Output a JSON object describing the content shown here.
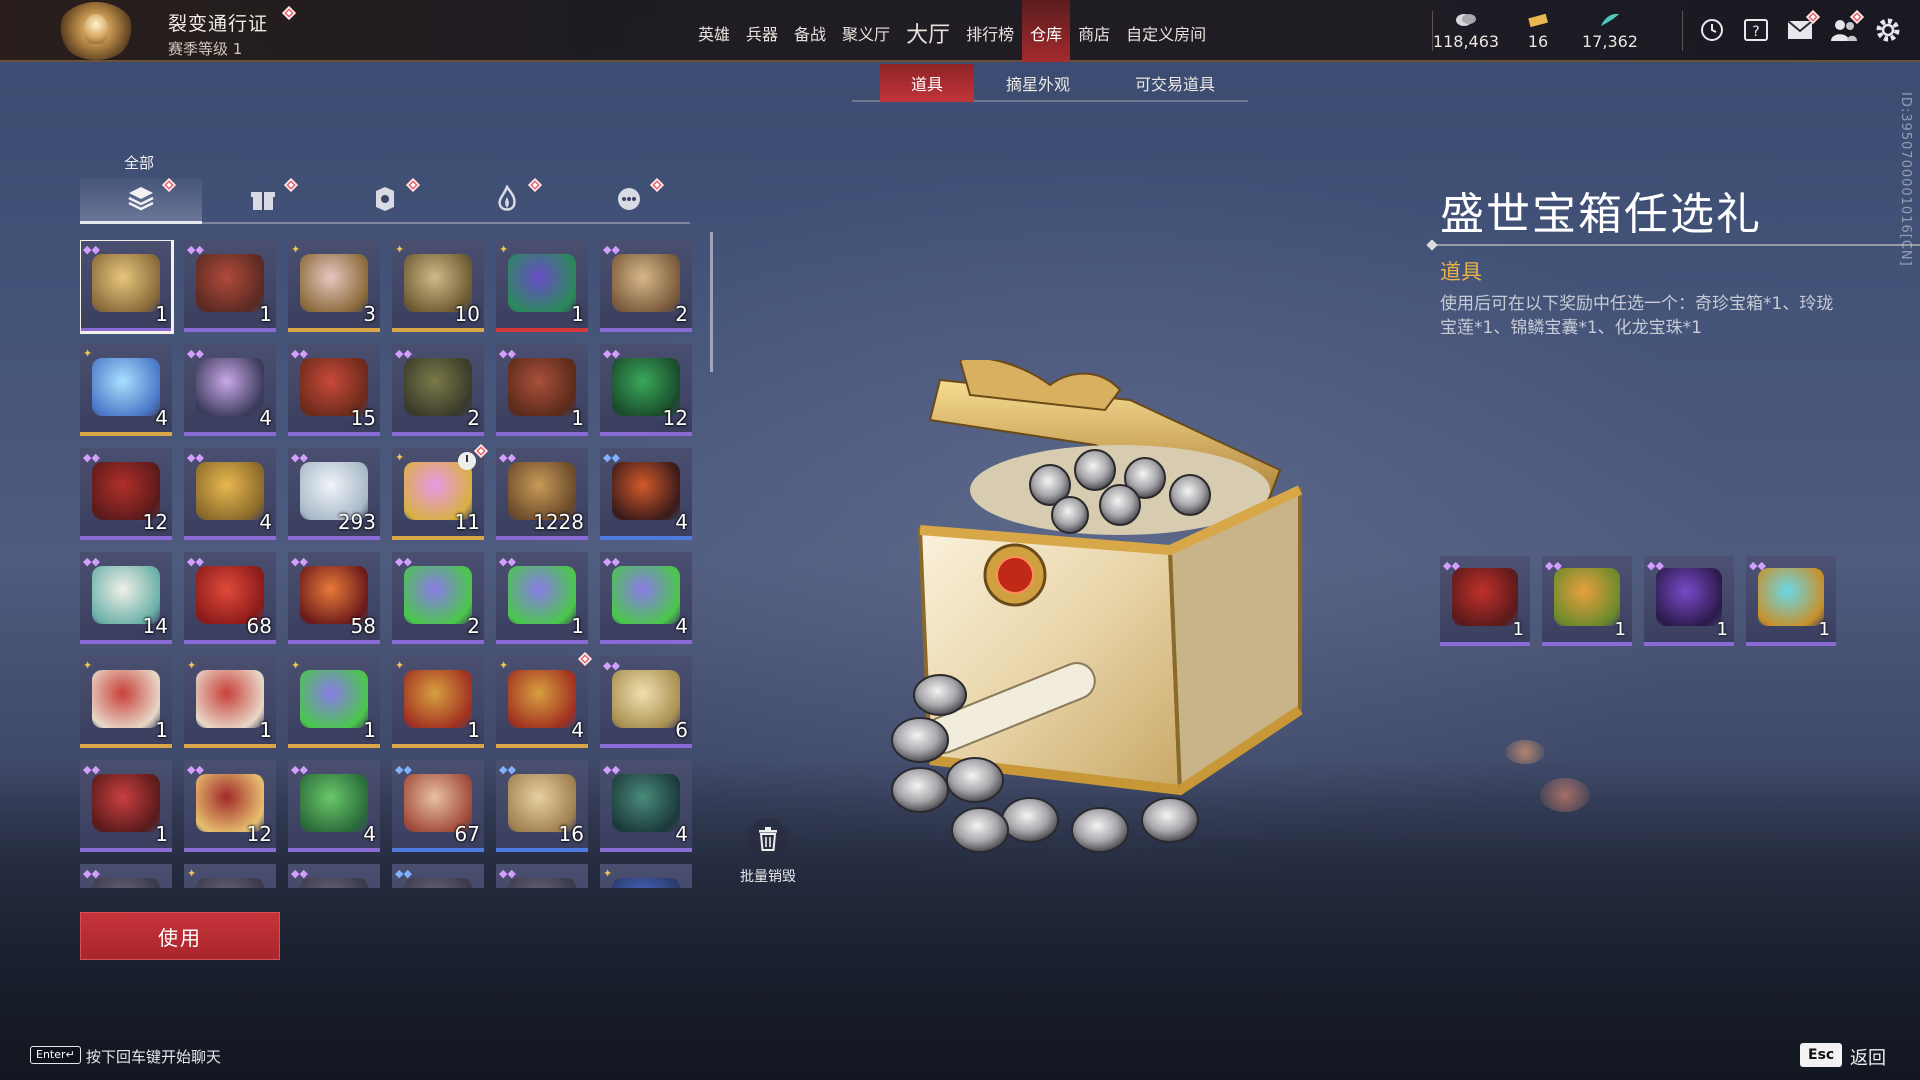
{
  "topbar": {
    "pass_title": "裂变通行证",
    "pass_level": "赛季等级 1",
    "nav": [
      {
        "label": "英雄",
        "badge": true,
        "big": false,
        "active": false
      },
      {
        "label": "兵器",
        "badge": false,
        "big": false,
        "active": false
      },
      {
        "label": "备战",
        "badge": false,
        "big": false,
        "active": false
      },
      {
        "label": "聚义厅",
        "badge": true,
        "big": false,
        "active": false
      },
      {
        "label": "大厅",
        "badge": false,
        "big": true,
        "active": false
      },
      {
        "label": "排行榜",
        "badge": false,
        "big": false,
        "active": false
      },
      {
        "label": "仓库",
        "badge": true,
        "big": false,
        "active": true
      },
      {
        "label": "商店",
        "badge": true,
        "big": false,
        "active": false
      },
      {
        "label": "自定义房间",
        "badge": false,
        "big": false,
        "active": false
      }
    ],
    "currencies": [
      {
        "icon": "coin-stack-icon",
        "value": "118,463"
      },
      {
        "icon": "gold-ticket-icon",
        "value": "16"
      },
      {
        "icon": "jade-feather-icon",
        "value": "17,362"
      }
    ],
    "system_icons": [
      "timer-icon",
      "help-book-icon",
      "mail-icon",
      "friends-icon",
      "settings-icon"
    ]
  },
  "subtabs": [
    {
      "label": "道具",
      "active": true
    },
    {
      "label": "摘星外观",
      "active": false
    },
    {
      "label": "可交易道具",
      "active": false
    }
  ],
  "categories": {
    "label": "全部",
    "items": [
      {
        "icon": "layers-icon",
        "active": true
      },
      {
        "icon": "gift-icon",
        "active": false
      },
      {
        "icon": "badge-icon",
        "active": false
      },
      {
        "icon": "flame-icon",
        "active": false
      },
      {
        "icon": "more-icon",
        "active": false
      }
    ]
  },
  "inventory": [
    {
      "qty": "1",
      "rarity": "purple",
      "art": [
        "#e7c77d",
        "#8a6a3a"
      ],
      "selected": true
    },
    {
      "qty": "1",
      "rarity": "purple",
      "art": [
        "#b04a3a",
        "#5a2a22"
      ]
    },
    {
      "qty": "3",
      "rarity": "gold",
      "art": [
        "#e8c6c0",
        "#8a6a3a"
      ]
    },
    {
      "qty": "10",
      "rarity": "gold",
      "art": [
        "#cdbb88",
        "#6d5a32"
      ]
    },
    {
      "qty": "1",
      "rarity": "red",
      "art": [
        "#6a4cc8",
        "#2a8a5a"
      ]
    },
    {
      "qty": "2",
      "rarity": "purple",
      "art": [
        "#d8b88a",
        "#7a5a3a"
      ]
    },
    {
      "qty": "4",
      "rarity": "gold",
      "art": [
        "#a8e0ff",
        "#4a78c8"
      ]
    },
    {
      "qty": "4",
      "rarity": "purple",
      "art": [
        "#c8a8e8",
        "#3a3a5a"
      ]
    },
    {
      "qty": "15",
      "rarity": "purple",
      "art": [
        "#c84a3a",
        "#6a2a1a"
      ]
    },
    {
      "qty": "2",
      "rarity": "purple",
      "art": [
        "#7a7a4a",
        "#3a3a2a"
      ]
    },
    {
      "qty": "1",
      "rarity": "purple",
      "art": [
        "#a8503a",
        "#5a2a1a"
      ]
    },
    {
      "qty": "12",
      "rarity": "purple",
      "art": [
        "#3aa85a",
        "#1a4a2a"
      ]
    },
    {
      "qty": "12",
      "rarity": "purple",
      "art": [
        "#b0302a",
        "#5a1a1a"
      ]
    },
    {
      "qty": "4",
      "rarity": "purple",
      "art": [
        "#e8b850",
        "#8a6a2a"
      ]
    },
    {
      "qty": "293",
      "rarity": "purple",
      "art": [
        "#f0f4f8",
        "#a8b8c8"
      ]
    },
    {
      "qty": "11",
      "rarity": "gold",
      "art": [
        "#e89ae8",
        "#d8b040"
      ],
      "timed": true,
      "badge": true
    },
    {
      "qty": "1228",
      "rarity": "purple",
      "art": [
        "#c89a58",
        "#6a4a2a"
      ]
    },
    {
      "qty": "4",
      "rarity": "blue",
      "art": [
        "#d05a2a",
        "#3a1a1a"
      ]
    },
    {
      "qty": "14",
      "rarity": "purple",
      "art": [
        "#f0f0e8",
        "#6ab0a8"
      ]
    },
    {
      "qty": "68",
      "rarity": "purple",
      "art": [
        "#e04a3a",
        "#8a1a1a"
      ]
    },
    {
      "qty": "58",
      "rarity": "purple",
      "art": [
        "#e87a3a",
        "#6a1a1a"
      ]
    },
    {
      "qty": "2",
      "rarity": "purple",
      "art": [
        "#8a7ae8",
        "#4ac84a"
      ]
    },
    {
      "qty": "1",
      "rarity": "purple",
      "art": [
        "#8a7ae8",
        "#4ac84a"
      ]
    },
    {
      "qty": "4",
      "rarity": "purple",
      "art": [
        "#8a7ae8",
        "#4ac84a"
      ]
    },
    {
      "qty": "1",
      "rarity": "gold",
      "art": [
        "#c8403a",
        "#e8d8c8"
      ]
    },
    {
      "qty": "1",
      "rarity": "gold",
      "art": [
        "#c8403a",
        "#e8d8c8"
      ]
    },
    {
      "qty": "1",
      "rarity": "gold",
      "art": [
        "#8a7ae8",
        "#4ac84a"
      ]
    },
    {
      "qty": "1",
      "rarity": "gold",
      "art": [
        "#d8a040",
        "#a03020"
      ]
    },
    {
      "qty": "4",
      "rarity": "gold",
      "art": [
        "#d8a040",
        "#a03020"
      ],
      "badge": true
    },
    {
      "qty": "6",
      "rarity": "purple",
      "art": [
        "#f0e0b0",
        "#a89050"
      ]
    },
    {
      "qty": "1",
      "rarity": "purple",
      "art": [
        "#c84040",
        "#5a1a1a"
      ]
    },
    {
      "qty": "12",
      "rarity": "purple",
      "art": [
        "#a02a2a",
        "#e8c070"
      ]
    },
    {
      "qty": "4",
      "rarity": "purple",
      "art": [
        "#6ac86a",
        "#2a6a3a"
      ]
    },
    {
      "qty": "67",
      "rarity": "blue",
      "art": [
        "#e8c0a0",
        "#a04a3a"
      ]
    },
    {
      "qty": "16",
      "rarity": "blue",
      "art": [
        "#e8d0a0",
        "#a08050"
      ]
    },
    {
      "qty": "4",
      "rarity": "purple",
      "art": [
        "#4a8a7a",
        "#1a3a3a"
      ]
    },
    {
      "qty": "",
      "rarity": "purple",
      "art": [
        "#6a6a7a",
        "#3a3a4a"
      ]
    },
    {
      "qty": "",
      "rarity": "gold",
      "art": [
        "#6a6a7a",
        "#3a3a4a"
      ]
    },
    {
      "qty": "",
      "rarity": "purple",
      "art": [
        "#6a6a7a",
        "#3a3a4a"
      ]
    },
    {
      "qty": "",
      "rarity": "blue",
      "art": [
        "#6a6a7a",
        "#3a3a4a"
      ]
    },
    {
      "qty": "",
      "rarity": "purple",
      "art": [
        "#6a6a7a",
        "#3a3a4a"
      ]
    },
    {
      "qty": "",
      "rarity": "gold",
      "art": [
        "#4a6ac8",
        "#2a3a6a"
      ]
    }
  ],
  "use_button": "使用",
  "destroy_label": "批量销毁",
  "detail": {
    "title": "盛世宝箱任选礼",
    "type": "道具",
    "description": "使用后可在以下奖励中任选一个：奇珍宝箱*1、玲珑宝莲*1、锦鳞宝囊*1、化龙宝珠*1",
    "rewards": [
      {
        "qty": "1",
        "art": [
          "#c0302a",
          "#5a1a1a"
        ]
      },
      {
        "qty": "1",
        "art": [
          "#e8a040",
          "#6a8a2a"
        ]
      },
      {
        "qty": "1",
        "art": [
          "#7a4ac8",
          "#2a1a4a"
        ]
      },
      {
        "qty": "1",
        "art": [
          "#6ad8e8",
          "#c8902a"
        ]
      }
    ]
  },
  "vertical_id": "ID:3950700001016[CN]",
  "footer": {
    "enter_key": "Enter↵",
    "chat_hint": "按下回车键开始聊天",
    "esc_key": "Esc",
    "back": "返回"
  },
  "colors": {
    "accent_red": "#c1353a",
    "rarity_purple": "#8a6bd6",
    "rarity_gold": "#d9a648",
    "rarity_blue": "#4f7be0",
    "item_type": "#e9b24a"
  }
}
